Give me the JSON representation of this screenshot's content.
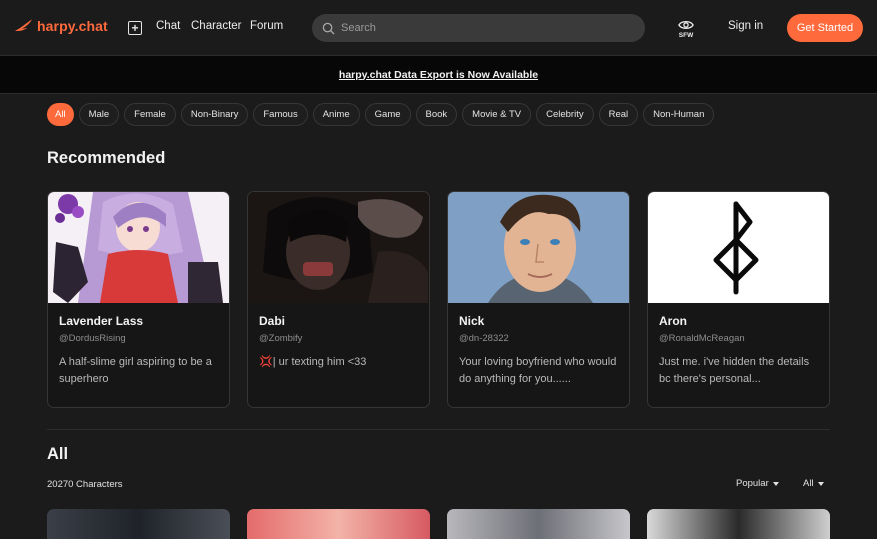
{
  "brand": {
    "name": "harpy.chat",
    "accent": "#ff6a3d"
  },
  "nav": {
    "new_chat_icon": "plus-square-icon",
    "links": [
      "Chat",
      "Character",
      "Forum"
    ],
    "search_placeholder": "Search",
    "sfw_label": "SFW",
    "sign_in": "Sign in",
    "get_started": "Get Started"
  },
  "banner": {
    "text": "harpy.chat Data Export is Now Available"
  },
  "filters": {
    "selected": "All",
    "chips": [
      "All",
      "Male",
      "Female",
      "Non-Binary",
      "Famous",
      "Anime",
      "Game",
      "Book",
      "Movie & TV",
      "Celebrity",
      "Real",
      "Non-Human"
    ]
  },
  "recommended": {
    "title": "Recommended",
    "cards": [
      {
        "name": "Lavender Lass",
        "handle": "@DordusRising",
        "description": "A half-slime girl aspiring to be a superhero"
      },
      {
        "name": "Dabi",
        "handle": "@Zombify",
        "description": "💢| ur texting him <33"
      },
      {
        "name": "Nick",
        "handle": "@dn-28322",
        "description": "Your loving boyfriend who would do anything for you......"
      },
      {
        "name": "Aron",
        "handle": "@RonaldMcReagan",
        "description": "Just me. i've hidden the details bc there's personal..."
      }
    ]
  },
  "all": {
    "title": "All",
    "count_text": "20270 Characters",
    "sort_label": "Popular",
    "filter_label": "All"
  }
}
